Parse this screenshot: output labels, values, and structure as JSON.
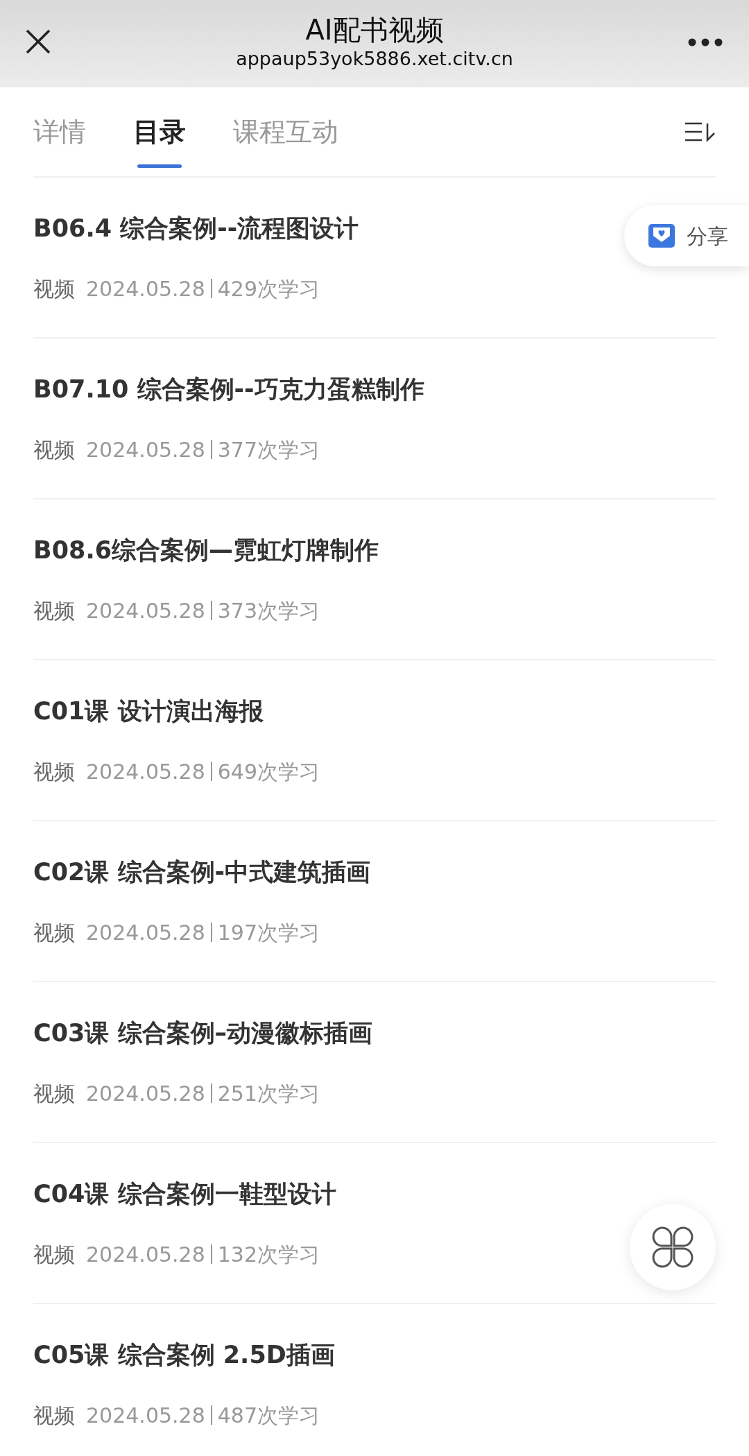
{
  "header": {
    "title": "AI配书视频",
    "url": "appaup53yok5886.xet.citv.cn"
  },
  "tabs": [
    {
      "label": "详情",
      "selected": false
    },
    {
      "label": "目录",
      "selected": true
    },
    {
      "label": "课程互动",
      "selected": false
    }
  ],
  "share_button": {
    "label": "分享"
  },
  "lessons": [
    {
      "title": "B06.4 综合案例--流程图设计",
      "type": "视频",
      "date": "2024.05.28",
      "views": "429次学习"
    },
    {
      "title": "B07.10 综合案例--巧克力蛋糕制作",
      "type": "视频",
      "date": "2024.05.28",
      "views": "377次学习"
    },
    {
      "title": "B08.6综合案例—霓虹灯牌制作",
      "type": "视频",
      "date": "2024.05.28",
      "views": "373次学习"
    },
    {
      "title": "C01课 设计演出海报",
      "type": "视频",
      "date": "2024.05.28",
      "views": "649次学习"
    },
    {
      "title": "C02课 综合案例-中式建筑插画",
      "type": "视频",
      "date": "2024.05.28",
      "views": "197次学习"
    },
    {
      "title": "C03课 综合案例–动漫徽标插画",
      "type": "视频",
      "date": "2024.05.28",
      "views": "251次学习"
    },
    {
      "title": "C04课 综合案例一鞋型设计",
      "type": "视频",
      "date": "2024.05.28",
      "views": "132次学习"
    },
    {
      "title": "C05课 综合案例 2.5D插画",
      "type": "视频",
      "date": "2024.05.28",
      "views": "487次学习"
    }
  ]
}
